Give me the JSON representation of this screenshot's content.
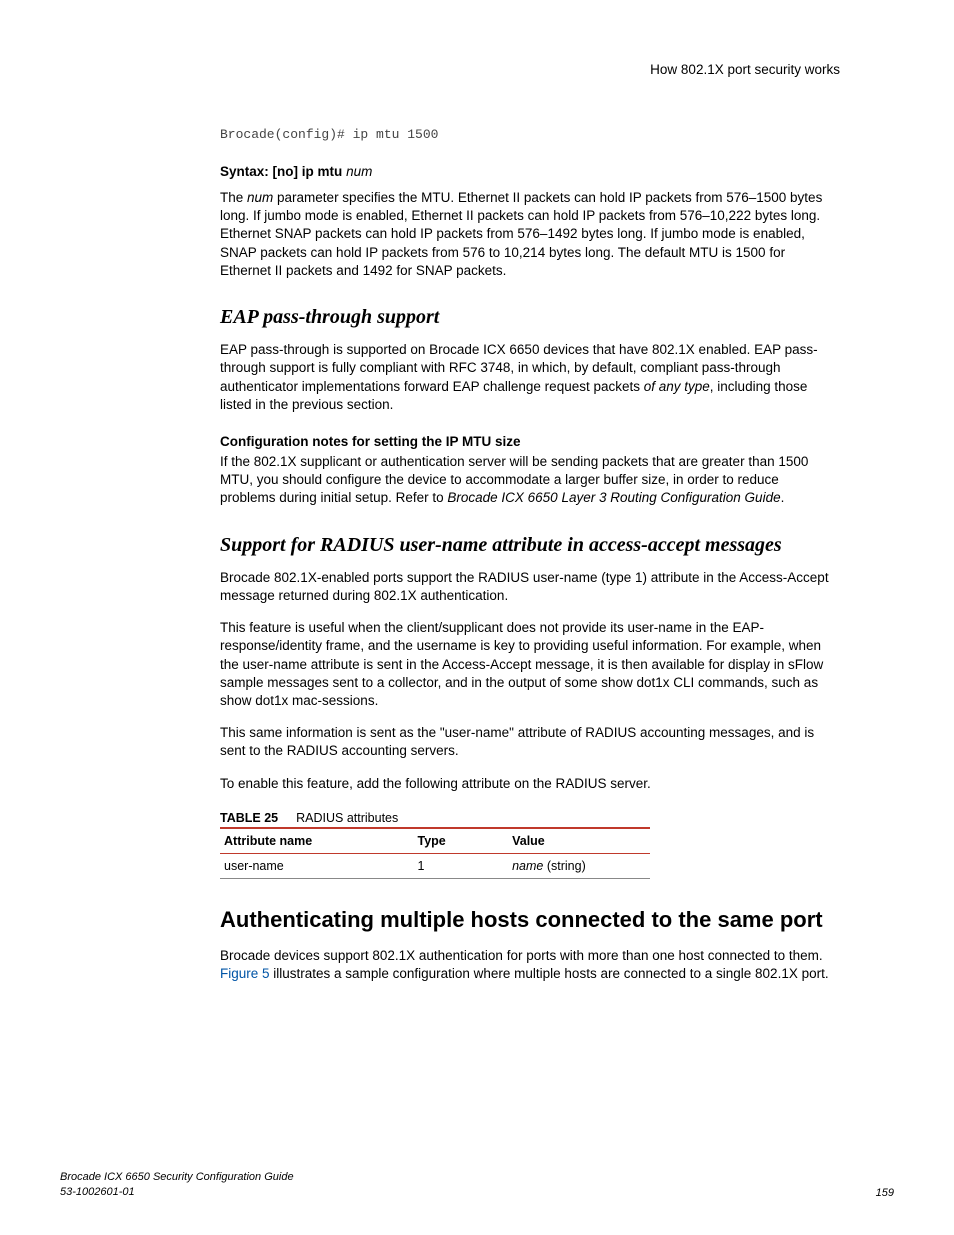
{
  "runningHead": "How 802.1X port security works",
  "codeLine": "Brocade(config)# ip mtu 1500",
  "syntax": {
    "label": "Syntax:",
    "optional": "[no]",
    "cmd": "ip mtu",
    "arg": "num"
  },
  "mtuPara_a": "The ",
  "mtuPara_num": "num",
  "mtuPara_b": " parameter specifies the MTU. Ethernet II packets can hold IP packets from 576–1500 bytes long. If jumbo mode is enabled, Ethernet II packets can hold IP packets from 576–10,222 bytes long. Ethernet SNAP packets can hold IP packets from 576–1492 bytes long. If jumbo mode is enabled, SNAP packets can hold IP packets from 576 to 10,214 bytes long. The default MTU is 1500 for Ethernet II packets and 1492 for SNAP packets.",
  "eapHead": "EAP pass-through support",
  "eapPara_a": "EAP pass-through is supported on Brocade ICX 6650 devices that have 802.1X enabled. EAP pass-through support is fully compliant with RFC 3748, in which, by default, compliant pass-through authenticator implementations forward EAP challenge request packets ",
  "eapPara_em": "of any type",
  "eapPara_b": ", including those listed in the previous section.",
  "cfgHead": "Configuration notes for setting the IP MTU size",
  "cfgPara_a": "If the 802.1X supplicant or authentication server will be sending packets that are greater than 1500 MTU, you should configure the device to accommodate a larger buffer size, in order to reduce problems during initial setup. Refer to ",
  "cfgPara_em": "Brocade ICX 6650 Layer 3 Routing Configuration Guide",
  "cfgPara_b": ".",
  "radiusHead": "Support for RADIUS user-name attribute in access-accept messages",
  "radiusP1": "Brocade 802.1X-enabled ports support the RADIUS user-name (type 1) attribute in the Access-Accept message returned during 802.1X authentication.",
  "radiusP2": "This feature is useful when the client/supplicant does not provide its user-name in the EAP-response/identity frame, and the username is key to providing useful information. For example, when the user-name attribute is sent in the Access-Accept message, it is then available for display in sFlow sample messages sent to a collector, and in the output of some show dot1x CLI commands, such as show dot1x mac-sessions.",
  "radiusP3": "This same information is sent as the \"user-name\" attribute of RADIUS accounting messages, and is sent to the RADIUS accounting servers.",
  "radiusP4": "To enable this feature, add the following attribute on the RADIUS server.",
  "tableNum": "TABLE 25",
  "tableTitle": "RADIUS attributes",
  "th1": "Attribute name",
  "th2": "Type",
  "th3": "Value",
  "td1": "user-name",
  "td2": "1",
  "td3_em": "name",
  "td3_b": " (string)",
  "multiHead": "Authenticating multiple hosts connected to the same port",
  "multiPara_a": "Brocade devices support 802.1X authentication for ports with more than one host connected to them. ",
  "multiPara_link": "Figure 5",
  "multiPara_b": " illustrates a sample configuration where multiple hosts are connected to a single 802.1X port.",
  "footerL1": "Brocade ICX 6650 Security Configuration Guide",
  "footerL2": "53-1002601-01",
  "footerPage": "159"
}
